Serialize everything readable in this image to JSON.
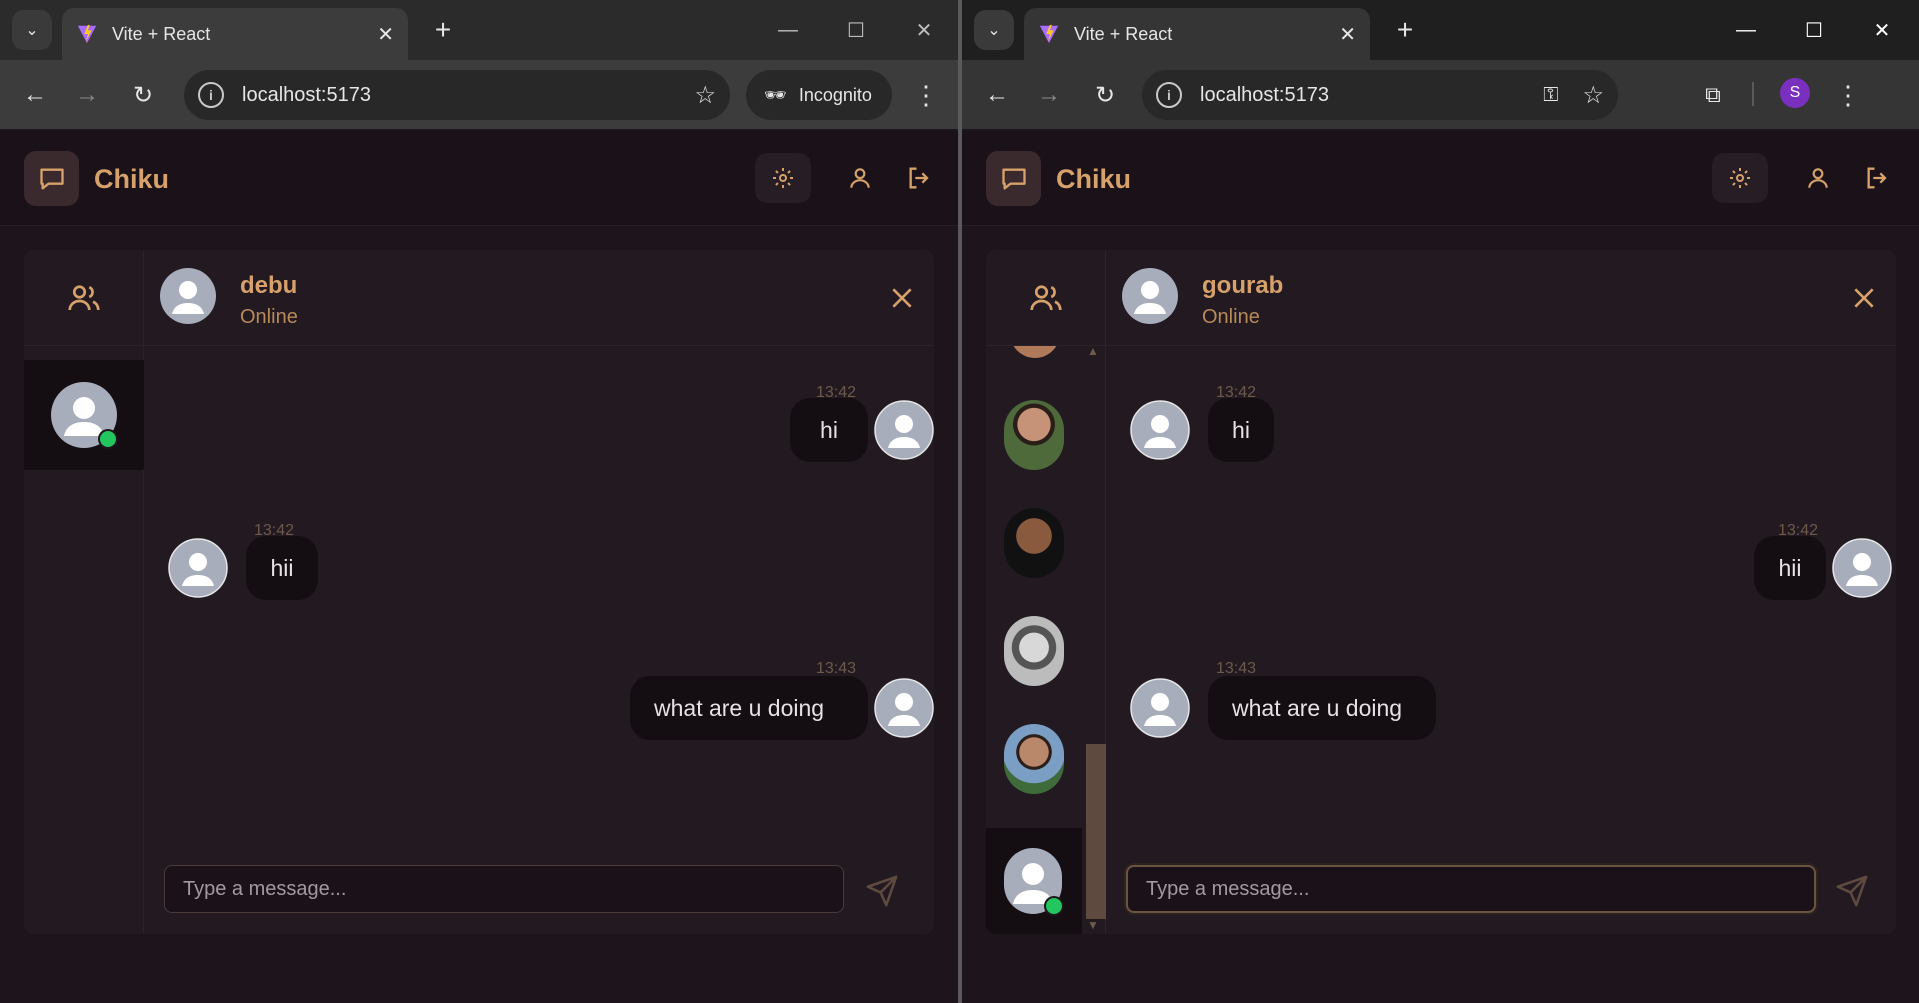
{
  "browser": {
    "tab_title": "Vite + React",
    "url": "localhost:5173",
    "incognito_label": "Incognito",
    "profile_initial": "S"
  },
  "app": {
    "brand": "Chiku",
    "accent": "#d6a16a",
    "online_color": "#22c55e",
    "input_placeholder": "Type a message..."
  },
  "left_window": {
    "chat_name": "debu",
    "chat_status": "Online",
    "messages": [
      {
        "time": "13:42",
        "text": "hi",
        "own": true
      },
      {
        "time": "13:42",
        "text": "hii",
        "own": false
      },
      {
        "time": "13:43",
        "text": "what are u doing",
        "own": true
      }
    ]
  },
  "right_window": {
    "chat_name": "gourab",
    "chat_status": "Online",
    "messages": [
      {
        "time": "13:42",
        "text": "hi",
        "own": false
      },
      {
        "time": "13:42",
        "text": "hii",
        "own": true
      },
      {
        "time": "13:43",
        "text": "what are u doing",
        "own": false
      }
    ]
  }
}
